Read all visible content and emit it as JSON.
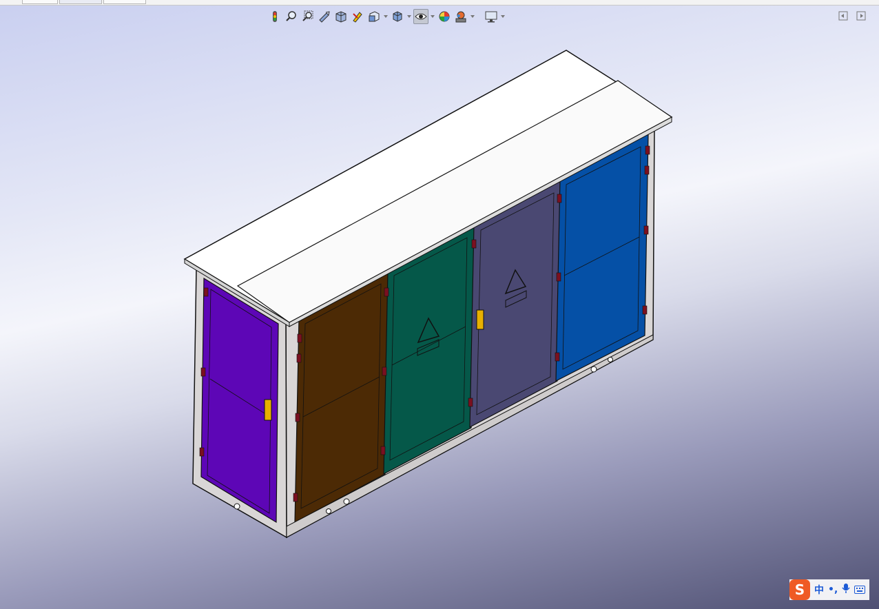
{
  "viewport": {
    "background_top": "#c9cff0",
    "background_bottom": "#4f5073"
  },
  "toolbar": {
    "buttons": [
      {
        "name": "previous-view-icon",
        "has_menu": false,
        "active": false
      },
      {
        "name": "zoom-to-fit-icon",
        "has_menu": false,
        "active": false
      },
      {
        "name": "zoom-to-area-icon",
        "has_menu": false,
        "active": false
      },
      {
        "name": "previous-view-arrow-icon",
        "has_menu": false,
        "active": false
      },
      {
        "name": "section-view-icon",
        "has_menu": false,
        "active": false
      },
      {
        "name": "dynamic-annotation-icon",
        "has_menu": false,
        "active": false
      },
      {
        "name": "view-orientation-icon",
        "has_menu": true,
        "active": false
      },
      {
        "name": "display-style-icon",
        "has_menu": true,
        "active": false
      },
      {
        "name": "hide-show-items-icon",
        "has_menu": true,
        "active": true
      },
      {
        "name": "edit-appearance-icon",
        "has_menu": false,
        "active": false
      },
      {
        "name": "apply-scene-icon",
        "has_menu": true,
        "active": false
      },
      {
        "name": "view-settings-icon",
        "has_menu": true,
        "active": false
      }
    ]
  },
  "model": {
    "name": "box-type-substation",
    "roof_color": "#ffffff",
    "frame_color": "#d9d6d6",
    "doors": [
      {
        "name": "door-violet",
        "color": "#5d06b6",
        "warning_sign": false,
        "lock": true
      },
      {
        "name": "door-brown",
        "color": "#4c2a05",
        "warning_sign": false,
        "lock": false
      },
      {
        "name": "door-teal",
        "color": "#055849",
        "warning_sign": true,
        "lock": false
      },
      {
        "name": "door-slate",
        "color": "#4a4872",
        "warning_sign": true,
        "lock": true
      },
      {
        "name": "door-blue",
        "color": "#0550a6",
        "warning_sign": false,
        "lock": false
      }
    ],
    "hinge_color": "#7a1020",
    "lock_color": "#e8b000"
  },
  "ime": {
    "logo": "S",
    "lang": "中",
    "punct": "•,",
    "mic_icon": "microphone-icon",
    "keyboard_icon": "keyboard-icon"
  }
}
